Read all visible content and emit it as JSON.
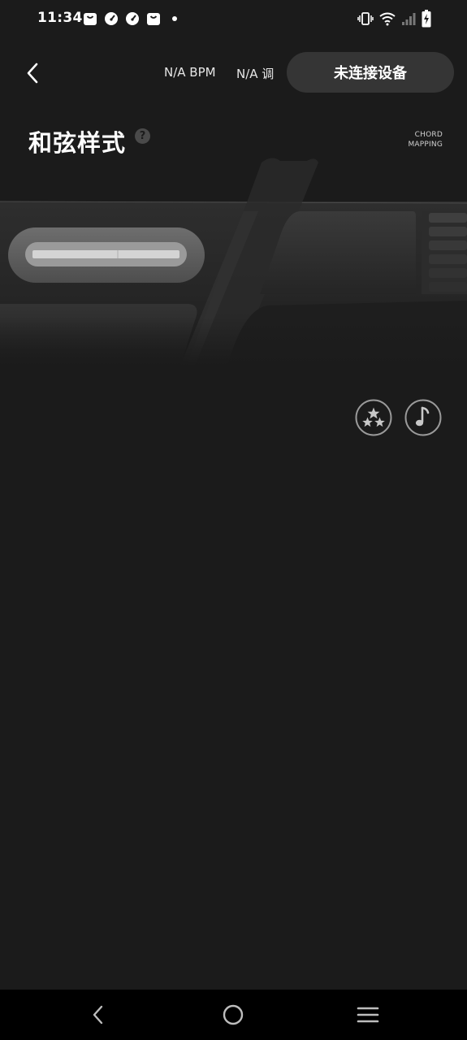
{
  "status_bar": {
    "time": "11:34",
    "notification_icons": [
      "shopping-bag-icon",
      "speed-gauge-icon",
      "speed-gauge-icon",
      "shopping-bag-icon"
    ],
    "system_icons": [
      "vibrate-icon",
      "wifi-icon",
      "signal-icon",
      "battery-charging-icon"
    ]
  },
  "top_bar": {
    "bpm_label": "N/A BPM",
    "key_label": "N/A 调",
    "connect_button_label": "未连接设备"
  },
  "page": {
    "title": "和弦样式",
    "help_symbol": "?",
    "subtitle_line1": "CHORD",
    "subtitle_line2": "MAPPING"
  },
  "actions": {
    "icons": [
      "stars-icon",
      "music-note-icon"
    ]
  },
  "nav_bar": {
    "buttons": [
      "back",
      "home",
      "menu"
    ]
  },
  "colors": {
    "background": "#1b1b1b",
    "button_bg": "#353535",
    "nav_bg": "#000000",
    "text": "#ffffff"
  }
}
